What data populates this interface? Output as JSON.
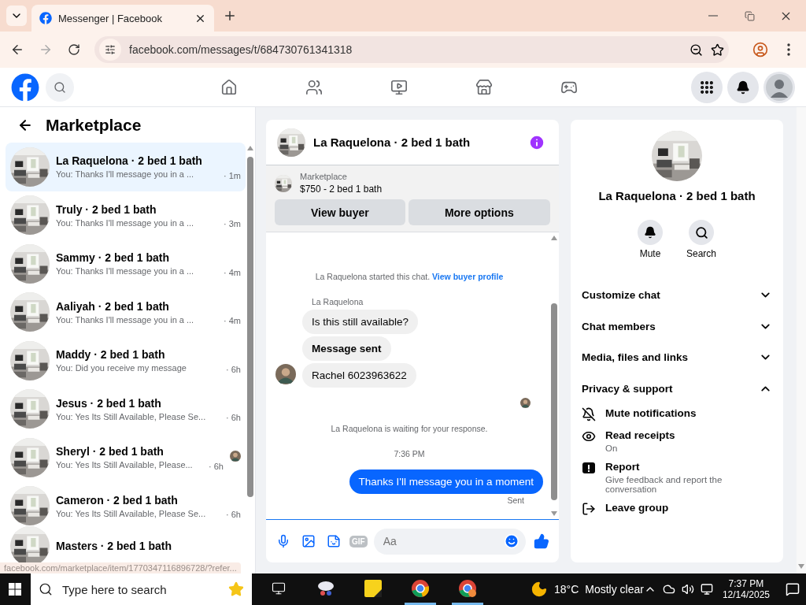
{
  "browser": {
    "tab": {
      "title": "Messenger | Facebook",
      "selected": true
    },
    "url": "facebook.com/messages/t/684730761341318",
    "status_url": "facebook.com/marketplace/item/1770347116896728/?refer..."
  },
  "left": {
    "title": "Marketplace",
    "chats": [
      {
        "name": "La Raquelona · 2 bed 1 bath",
        "preview": "You: Thanks I'll message you in a ...",
        "time": "· 1m",
        "selected": true,
        "seen": false
      },
      {
        "name": "Truly · 2 bed 1 bath",
        "preview": "You: Thanks I'll message you in a ...",
        "time": "· 3m",
        "selected": false,
        "seen": false
      },
      {
        "name": "Sammy · 2 bed 1 bath",
        "preview": "You: Thanks I'll message you in a ...",
        "time": "· 4m",
        "selected": false,
        "seen": false
      },
      {
        "name": "Aaliyah · 2 bed 1 bath",
        "preview": "You: Thanks I'll message you in a ...",
        "time": "· 4m",
        "selected": false,
        "seen": false
      },
      {
        "name": "Maddy · 2 bed 1 bath",
        "preview": "You: Did you receive my message",
        "time": "· 6h",
        "selected": false,
        "seen": false
      },
      {
        "name": "Jesus · 2 bed 1 bath",
        "preview": "You: Yes Its Still Available, Please Se...",
        "time": "· 6h",
        "selected": false,
        "seen": false
      },
      {
        "name": "Sheryl · 2 bed 1 bath",
        "preview": "You: Yes Its Still Available, Please...",
        "time": "· 6h",
        "selected": false,
        "seen": true
      },
      {
        "name": "Cameron · 2 bed 1 bath",
        "preview": "You: Yes Its Still Available, Please Se...",
        "time": "· 6h",
        "selected": false,
        "seen": false
      },
      {
        "name": "Masters · 2 bed 1 bath",
        "selected": false,
        "seen": false
      }
    ]
  },
  "conversation": {
    "title": "La Raquelona · 2 bed 1 bath",
    "listing": {
      "label": "Marketplace",
      "price": "$750 - 2 bed 1 bath"
    },
    "buttons": [
      "View buyer",
      "More options"
    ],
    "messages": [
      {
        "kind": "system",
        "text": "La Raquelona started this chat.",
        "link": "View buyer profile"
      },
      {
        "kind": "sender",
        "text": "La Raquelona"
      },
      {
        "kind": "incoming",
        "text": "Is this still available?",
        "bold": false,
        "avatar": false
      },
      {
        "kind": "incoming",
        "text": "Message sent",
        "bold": true,
        "avatar": false
      },
      {
        "kind": "incoming",
        "text": "Rachel 6023963622",
        "bold": false,
        "avatar": true
      },
      {
        "kind": "seen"
      },
      {
        "kind": "system",
        "text": "La Raquelona is waiting for your response."
      },
      {
        "kind": "time",
        "text": "7:36 PM"
      },
      {
        "kind": "outgoing",
        "text": "Thanks I'll message you in a moment"
      },
      {
        "kind": "status",
        "text": "Sent"
      }
    ],
    "composer": {
      "gif": "GIF",
      "placeholder": "Aa"
    }
  },
  "details": {
    "title": "La Raquelona · 2 bed 1 bath",
    "actions": [
      "Mute",
      "Search"
    ],
    "sections": [
      {
        "label": "Customize chat",
        "expanded": false
      },
      {
        "label": "Chat members",
        "expanded": false
      },
      {
        "label": "Media, files and links",
        "expanded": false
      },
      {
        "label": "Privacy & support",
        "expanded": true,
        "items": [
          {
            "label": "Mute notifications"
          },
          {
            "label": "Read receipts",
            "detail": "On"
          },
          {
            "label": "Report",
            "detail": "Give feedback and report the conversation"
          },
          {
            "label": "Leave group"
          }
        ]
      }
    ]
  },
  "taskbar": {
    "placeholder": "Type here to search",
    "temperature": "18°C",
    "weather": "Mostly clear",
    "time": "7:37 PM",
    "date": "12/14/2025"
  }
}
